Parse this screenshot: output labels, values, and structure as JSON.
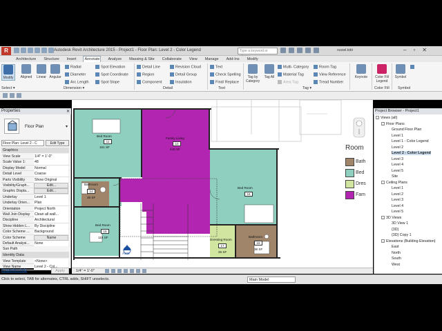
{
  "app": {
    "logo": "R",
    "title": "Autodesk Revit Architecture 2015 -    Project1 - Floor Plan: Level 2 - Color Legend",
    "search_placeholder": "Type a keyword or phrase",
    "user": "russel.tobi",
    "window_controls": [
      "–",
      "▫",
      "✕"
    ]
  },
  "ribbon_tabs": [
    "Architecture",
    "Structure",
    "Insert",
    "Annotate",
    "Analyze",
    "Massing & Site",
    "Collaborate",
    "View",
    "Manage",
    "Add-Ins",
    "Modify"
  ],
  "ribbon_active_tab": "Annotate",
  "ribbon": {
    "modify": "Modify",
    "aligned": "Aligned",
    "linear": "Linear",
    "angular": "Angular",
    "radial": "Radial",
    "diameter": "Diameter",
    "arc_length": "Arc Length",
    "spot_elevation": "Spot Elevation",
    "spot_coordinate": "Spot Coordinate",
    "spot_slope": "Spot Slope",
    "detail_line": "Detail Line",
    "region": "Region",
    "component": "Component",
    "revision_cloud": "Revision Cloud",
    "detail_group": "Detail Group",
    "insulation": "Insulation",
    "text": "Text",
    "check_spelling": "Check Spelling",
    "find_replace": "Find/ Replace",
    "tag_by_category": "Tag by Category",
    "tag_all": "Tag All",
    "multi_category": "Multi- Category",
    "material_tag": "Material Tag",
    "area_tag": "Area Tag",
    "room_tag": "Room Tag",
    "view_reference": "View Reference",
    "tread_number": "Tread Number",
    "keynote": "Keynote",
    "color_fill_legend": "Color Fill Legend",
    "symbol": "Symbol",
    "panels": {
      "select": "Select ▾",
      "dimension": "Dimension ▾",
      "detail": "Detail",
      "text": "Text",
      "tag": "Tag ▾",
      "color_fill": "Color Fill",
      "symbol": "Symbol"
    }
  },
  "properties": {
    "header": "Properties",
    "close": "✕",
    "type_name": "Floor Plan",
    "instance": "Floor Plan: Level 2 - C",
    "edit_type": "Edit Type",
    "category_graphics": "Graphics",
    "category_identity": "Identity Data",
    "rows": [
      {
        "k": "View Scale",
        "v": "1/4\" = 1'-0\"",
        "btn": false
      },
      {
        "k": "Scale Value   1:",
        "v": "48",
        "btn": false
      },
      {
        "k": "Display Model",
        "v": "Normal",
        "btn": false
      },
      {
        "k": "Detail Level",
        "v": "Coarse",
        "btn": false
      },
      {
        "k": "Parts Visibility",
        "v": "Show Original",
        "btn": false
      },
      {
        "k": "Visibility/Graph...",
        "v": "Edit...",
        "btn": true
      },
      {
        "k": "Graphic Displa...",
        "v": "Edit...",
        "btn": true
      },
      {
        "k": "Underlay",
        "v": "Level 1",
        "btn": false
      },
      {
        "k": "Underlay Orien...",
        "v": "Plan",
        "btn": false
      },
      {
        "k": "Orientation",
        "v": "Project North",
        "btn": false
      },
      {
        "k": "Wall Join Display",
        "v": "Clean all wall...",
        "btn": false
      },
      {
        "k": "Discipline",
        "v": "Architectural",
        "btn": false
      },
      {
        "k": "Show Hidden L...",
        "v": "By Discipline",
        "btn": false
      },
      {
        "k": "Color Scheme ...",
        "v": "Background",
        "btn": false
      },
      {
        "k": "Color Scheme",
        "v": "Name",
        "btn": true
      },
      {
        "k": "Default Analysi...",
        "v": "None",
        "btn": false
      },
      {
        "k": "Sun Path",
        "v": "",
        "btn": false
      }
    ],
    "identity_rows": [
      {
        "k": "View Template",
        "v": "<None>"
      },
      {
        "k": "View Name",
        "v": "Level 2 - Col..."
      }
    ],
    "help": "Properties help",
    "apply": "Apply"
  },
  "view_bar": {
    "scale": "1/4\" = 1'-0\""
  },
  "plan": {
    "rooms": [
      {
        "name": "Bed Room",
        "number": "11",
        "area": "161 SF"
      },
      {
        "name": "Family Living",
        "number": "10",
        "area": "440 SF"
      },
      {
        "name": "Bathroom",
        "number": "14",
        "area": "36 SF"
      },
      {
        "name": "Bed Room",
        "number": "16",
        "area": ""
      },
      {
        "name": "Bed Room",
        "number": "15",
        "area": "110 SF"
      },
      {
        "name": "Dressing Room",
        "number": "17",
        "area": "26 SF"
      },
      {
        "name": "Bathroom",
        "number": "18",
        "area": "36 SF"
      }
    ],
    "elevation_tag": "A102",
    "legend_title": "Room",
    "legend": [
      {
        "label": "Bath",
        "color": "#a0856a"
      },
      {
        "label": "Bed",
        "color": "#8ecfc0"
      },
      {
        "label": "Dres",
        "color": "#cfe5a0"
      },
      {
        "label": "Fam",
        "color": "#b225b0"
      }
    ]
  },
  "browser": {
    "header": "Project Browser - Project1",
    "items": [
      {
        "label": "Views (all)",
        "level": 0,
        "toggle": "-",
        "selected": false
      },
      {
        "label": "Floor Plans",
        "level": 1,
        "toggle": "-",
        "selected": false
      },
      {
        "label": "Ground Floor Plan",
        "level": 2,
        "toggle": "",
        "selected": false
      },
      {
        "label": "Level 1",
        "level": 2,
        "toggle": "",
        "selected": false
      },
      {
        "label": "Level 1 - Color Legend",
        "level": 2,
        "toggle": "",
        "selected": false
      },
      {
        "label": "Level 2",
        "level": 2,
        "toggle": "",
        "selected": false
      },
      {
        "label": "Level 2 - Color Legend",
        "level": 2,
        "toggle": "",
        "selected": true
      },
      {
        "label": "Level 3",
        "level": 2,
        "toggle": "",
        "selected": false
      },
      {
        "label": "Level 4",
        "level": 2,
        "toggle": "",
        "selected": false
      },
      {
        "label": "Level 5",
        "level": 2,
        "toggle": "",
        "selected": false
      },
      {
        "label": "Site",
        "level": 2,
        "toggle": "",
        "selected": false
      },
      {
        "label": "Ceiling Plans",
        "level": 1,
        "toggle": "-",
        "selected": false
      },
      {
        "label": "Level 1",
        "level": 2,
        "toggle": "",
        "selected": false
      },
      {
        "label": "Level 2",
        "level": 2,
        "toggle": "",
        "selected": false
      },
      {
        "label": "Level 3",
        "level": 2,
        "toggle": "",
        "selected": false
      },
      {
        "label": "Level 4",
        "level": 2,
        "toggle": "",
        "selected": false
      },
      {
        "label": "Level 5",
        "level": 2,
        "toggle": "",
        "selected": false
      },
      {
        "label": "3D Views",
        "level": 1,
        "toggle": "-",
        "selected": false
      },
      {
        "label": "3D View 1",
        "level": 2,
        "toggle": "",
        "selected": false
      },
      {
        "label": "{3D}",
        "level": 2,
        "toggle": "",
        "selected": false
      },
      {
        "label": "{3D} Copy 1",
        "level": 2,
        "toggle": "",
        "selected": false
      },
      {
        "label": "Elevations (Building Elevation)",
        "level": 1,
        "toggle": "-",
        "selected": false
      },
      {
        "label": "East",
        "level": 2,
        "toggle": "",
        "selected": false
      },
      {
        "label": "North",
        "level": 2,
        "toggle": "",
        "selected": false
      },
      {
        "label": "South",
        "level": 2,
        "toggle": "",
        "selected": false
      },
      {
        "label": "West",
        "level": 2,
        "toggle": "",
        "selected": false
      }
    ]
  },
  "status": {
    "text": "Click to select, TAB for alternates, CTRL adds, SHIFT unselects.",
    "model": "Main Model"
  }
}
